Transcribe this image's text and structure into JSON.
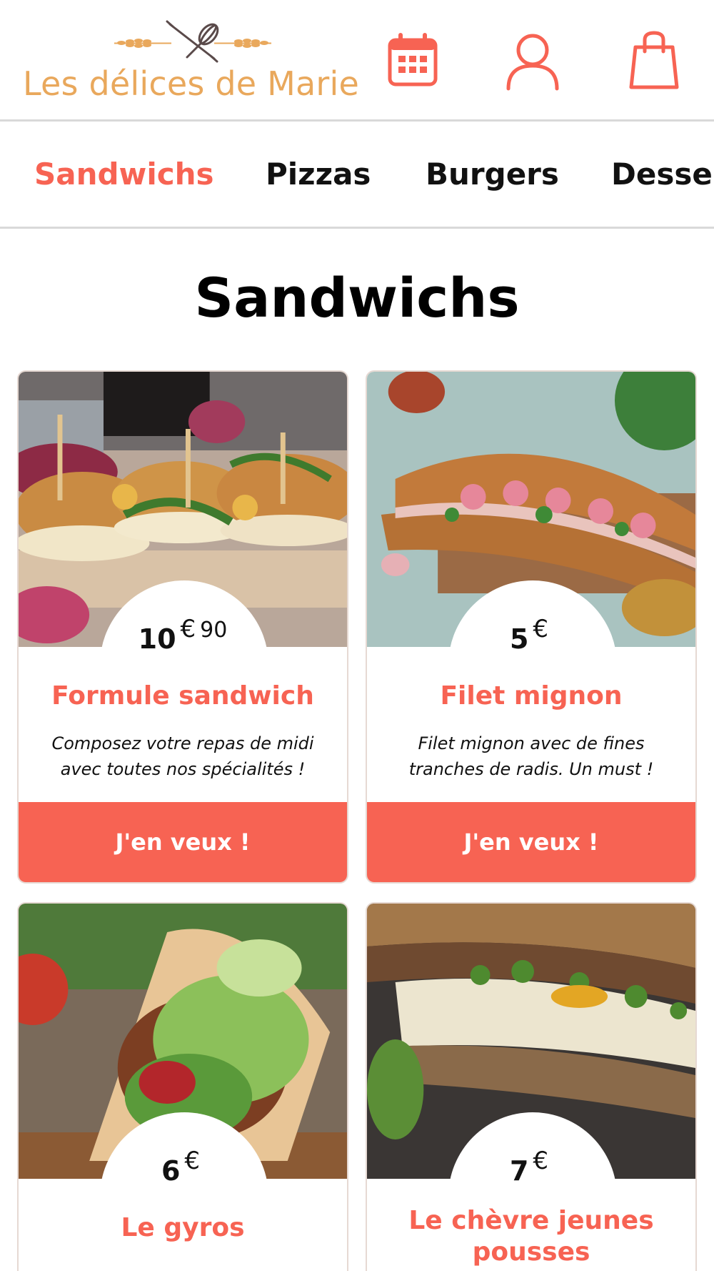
{
  "brand": {
    "name": "Les délices de Marie",
    "logo_color": "#e9a85c",
    "accent": "#f76353"
  },
  "header": {
    "icons": [
      "calendar-icon",
      "user-icon",
      "shopping-bag-icon"
    ]
  },
  "nav": {
    "categories": [
      {
        "label": "Sandwichs",
        "active": true
      },
      {
        "label": "Pizzas",
        "active": false
      },
      {
        "label": "Burgers",
        "active": false
      },
      {
        "label": "Desser",
        "active": false
      }
    ]
  },
  "section": {
    "title": "Sandwichs"
  },
  "products": [
    {
      "name": "Formule sandwich",
      "price_int": "10",
      "price_currency": "€",
      "price_dec": "90",
      "description": "Composez votre repas de midi avec toutes nos spécialités !",
      "cta": "J'en veux !"
    },
    {
      "name": "Filet mignon",
      "price_int": "5",
      "price_currency": "€",
      "price_dec": "",
      "description": "Filet mignon avec de fines tranches de radis. Un must !",
      "cta": "J'en veux !"
    },
    {
      "name": "Le gyros",
      "price_int": "6",
      "price_currency": "€",
      "price_dec": ""
    },
    {
      "name": "Le chèvre jeunes pousses",
      "price_int": "7",
      "price_currency": "€",
      "price_dec": ""
    }
  ]
}
